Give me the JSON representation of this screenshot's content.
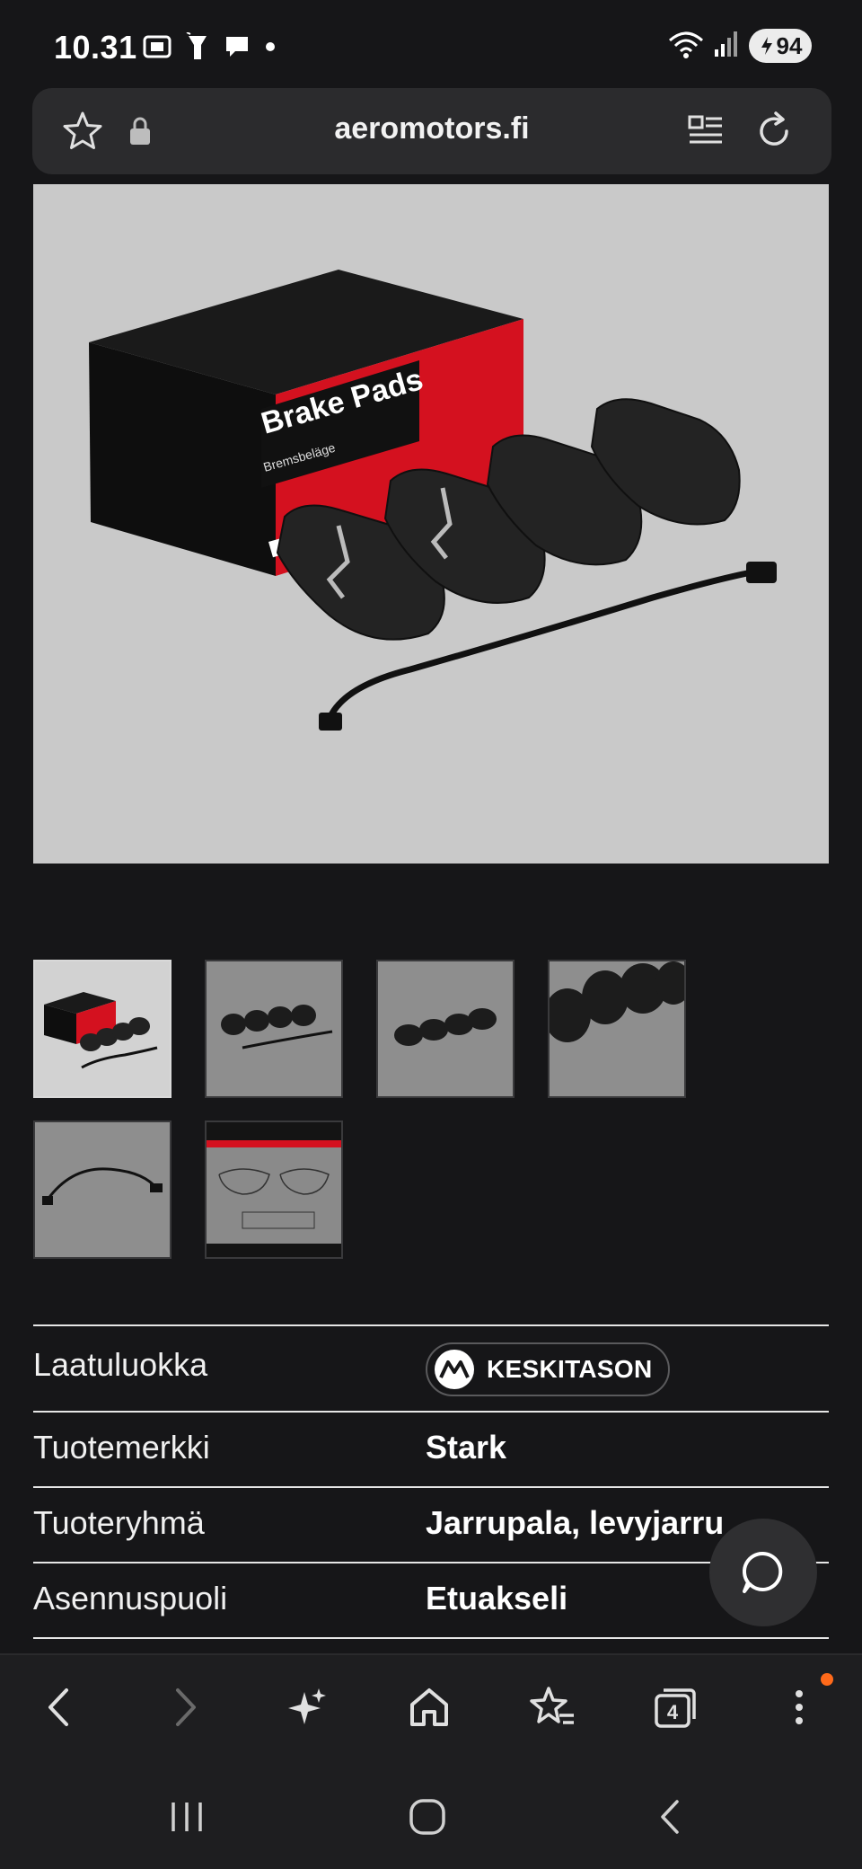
{
  "status_bar": {
    "time": "10.31",
    "battery": "94",
    "icons_left": [
      "screenshot-icon",
      "flashlight-icon",
      "chat-bubble-icon",
      "dot-icon"
    ],
    "icons_right": [
      "wifi-icon",
      "signal-icon",
      "battery-icon"
    ]
  },
  "browser": {
    "url": "aeromotors.fi",
    "icons": [
      "star-icon",
      "lock-icon",
      "reader-mode-icon",
      "reload-icon"
    ]
  },
  "product": {
    "box_title": "Brake Pads",
    "box_subtitle": "Bremsbeläge",
    "thumbnail_count": 6,
    "active_thumbnail": 1
  },
  "specs": {
    "quality": {
      "label": "Laatuluokka",
      "value": "KESKITASON"
    },
    "brand": {
      "label": "Tuotemerkki",
      "value": "Stark"
    },
    "group": {
      "label": "Tuoteryhmä",
      "value": "Jarrupala, levyjarru"
    },
    "side": {
      "label": "Asennuspuoli",
      "value": "Etuakseli"
    }
  },
  "toolbar": {
    "tabs_count": "4",
    "icons": [
      "back-icon",
      "forward-icon",
      "ai-sparkle-icon",
      "home-icon",
      "bookmarks-icon",
      "tabs-icon",
      "more-icon"
    ]
  },
  "colors": {
    "background": "#161618",
    "notification": "#ff6a1a",
    "box_red": "#d4111f"
  }
}
